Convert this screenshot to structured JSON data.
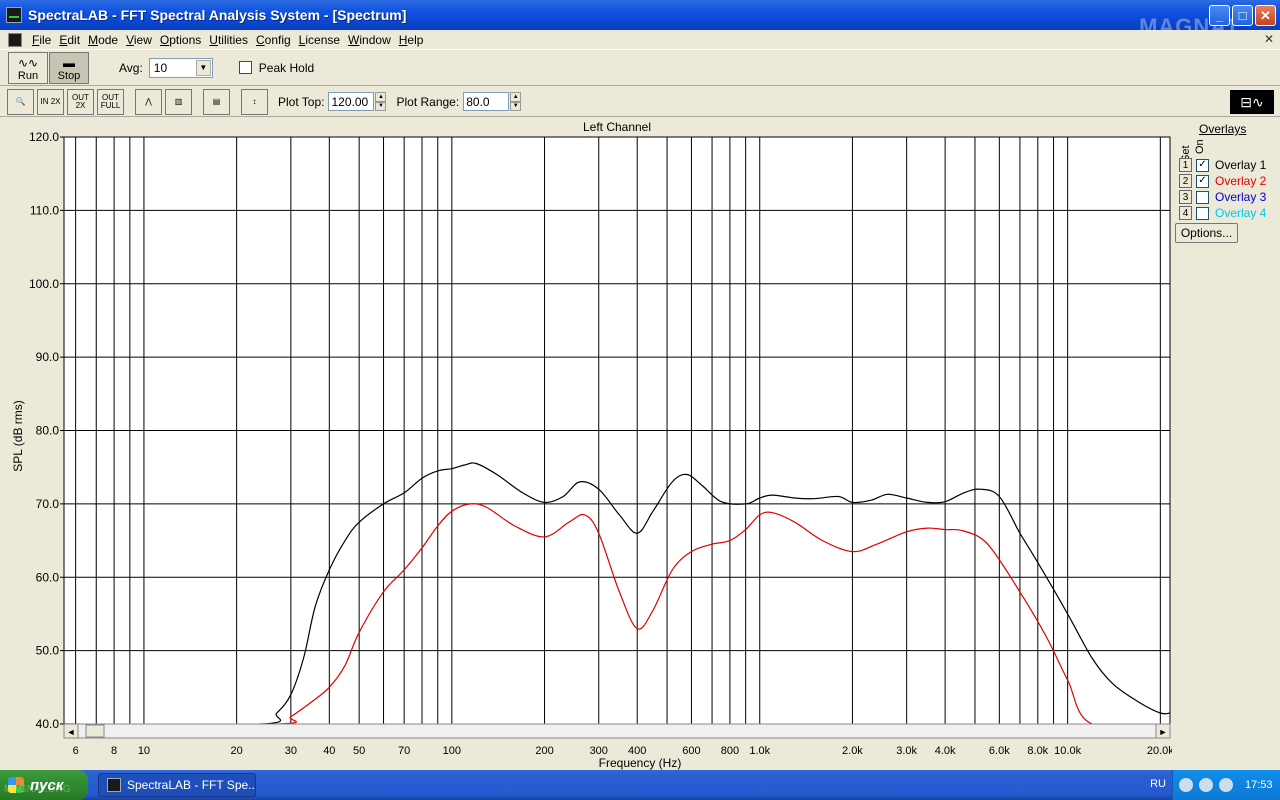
{
  "window": {
    "title": "SpectraLAB - FFT Spectral Analysis System - [Spectrum]",
    "watermark": "MAGNAT"
  },
  "menu": [
    "File",
    "Edit",
    "Mode",
    "View",
    "Options",
    "Utilities",
    "Config",
    "License",
    "Window",
    "Help"
  ],
  "toolbar": {
    "run_label": "Run",
    "stop_label": "Stop",
    "avg_label": "Avg:",
    "avg_value": "10",
    "peak_hold_label": "Peak Hold",
    "plot_top_label": "Plot Top:",
    "plot_top_value": "120.00",
    "plot_range_label": "Plot Range:",
    "plot_range_value": "80.0",
    "zoom_in_label": "IN 2X",
    "zoom_out_label": "OUT 2X",
    "zoom_full_label": "OUT FULL"
  },
  "overlays": {
    "title": "Overlays",
    "set_label": "Set",
    "on_label": "On",
    "options_label": "Options...",
    "items": [
      {
        "num": "1",
        "name": "Overlay 1",
        "checked": true,
        "color": "#000000"
      },
      {
        "num": "2",
        "name": "Overlay 2",
        "checked": true,
        "color": "#e00000"
      },
      {
        "num": "3",
        "name": "Overlay 3",
        "checked": false,
        "color": "#0000c0"
      },
      {
        "num": "4",
        "name": "Overlay 4",
        "checked": false,
        "color": "#00c8e8"
      }
    ]
  },
  "chart_data": {
    "type": "line",
    "title": "Left Channel",
    "xlabel": "Frequency (Hz)",
    "ylabel": "SPL (dB rms)",
    "xscale": "log",
    "xlim": [
      5.5,
      21500
    ],
    "ylim": [
      40,
      120
    ],
    "grid": true,
    "yticks": [
      "40.0",
      "50.0",
      "60.0",
      "70.0",
      "80.0",
      "90.0",
      "100.0",
      "110.0",
      "120.0"
    ],
    "xticks": [
      {
        "v": 6,
        "label": "6"
      },
      {
        "v": 8,
        "label": "8"
      },
      {
        "v": 10,
        "label": "10"
      },
      {
        "v": 20,
        "label": "20"
      },
      {
        "v": 30,
        "label": "30"
      },
      {
        "v": 40,
        "label": "40"
      },
      {
        "v": 50,
        "label": "50"
      },
      {
        "v": 70,
        "label": "70"
      },
      {
        "v": 100,
        "label": "100"
      },
      {
        "v": 200,
        "label": "200"
      },
      {
        "v": 300,
        "label": "300"
      },
      {
        "v": 400,
        "label": "400"
      },
      {
        "v": 600,
        "label": "600"
      },
      {
        "v": 800,
        "label": "800"
      },
      {
        "v": 1000,
        "label": "1.0k"
      },
      {
        "v": 2000,
        "label": "2.0k"
      },
      {
        "v": 3000,
        "label": "3.0k"
      },
      {
        "v": 4000,
        "label": "4.0k"
      },
      {
        "v": 6000,
        "label": "6.0k"
      },
      {
        "v": 8000,
        "label": "8.0k"
      },
      {
        "v": 10000,
        "label": "10.0k"
      },
      {
        "v": 20000,
        "label": "20.0k"
      }
    ],
    "series": [
      {
        "name": "Overlay 1",
        "color": "#000000",
        "points": [
          [
            5.5,
            40
          ],
          [
            24,
            40
          ],
          [
            27,
            41.5
          ],
          [
            30,
            44
          ],
          [
            33,
            49
          ],
          [
            36,
            56
          ],
          [
            40,
            61
          ],
          [
            45,
            65
          ],
          [
            50,
            67.5
          ],
          [
            60,
            70
          ],
          [
            70,
            71.5
          ],
          [
            80,
            73.5
          ],
          [
            90,
            74.5
          ],
          [
            100,
            74.8
          ],
          [
            110,
            75.3
          ],
          [
            120,
            75.5
          ],
          [
            140,
            74
          ],
          [
            170,
            71.5
          ],
          [
            200,
            70.2
          ],
          [
            230,
            71
          ],
          [
            260,
            73
          ],
          [
            300,
            72
          ],
          [
            350,
            68.5
          ],
          [
            400,
            66
          ],
          [
            450,
            69
          ],
          [
            520,
            73
          ],
          [
            580,
            74
          ],
          [
            650,
            72.5
          ],
          [
            750,
            70.3
          ],
          [
            900,
            70
          ],
          [
            1000,
            70.8
          ],
          [
            1100,
            71.2
          ],
          [
            1300,
            70.8
          ],
          [
            1500,
            70.7
          ],
          [
            1800,
            71
          ],
          [
            2000,
            70.2
          ],
          [
            2300,
            70.5
          ],
          [
            2600,
            71.3
          ],
          [
            3000,
            70.8
          ],
          [
            3500,
            70.2
          ],
          [
            4000,
            70.3
          ],
          [
            4600,
            71.5
          ],
          [
            5200,
            72
          ],
          [
            6000,
            71
          ],
          [
            7000,
            66
          ],
          [
            8000,
            62
          ],
          [
            10000,
            55
          ],
          [
            12000,
            49
          ],
          [
            14000,
            45.5
          ],
          [
            17000,
            43
          ],
          [
            20000,
            41.5
          ],
          [
            21500,
            41.5
          ]
        ]
      },
      {
        "name": "Overlay 2",
        "color": "#e00000",
        "points": [
          [
            5.5,
            40
          ],
          [
            27,
            40
          ],
          [
            30,
            41
          ],
          [
            35,
            43
          ],
          [
            40,
            45
          ],
          [
            45,
            48
          ],
          [
            50,
            52.5
          ],
          [
            60,
            58
          ],
          [
            70,
            61
          ],
          [
            80,
            64
          ],
          [
            90,
            67
          ],
          [
            100,
            69
          ],
          [
            115,
            70
          ],
          [
            130,
            69.5
          ],
          [
            160,
            67
          ],
          [
            200,
            65.5
          ],
          [
            240,
            67.5
          ],
          [
            270,
            68.5
          ],
          [
            300,
            66
          ],
          [
            350,
            58
          ],
          [
            400,
            53
          ],
          [
            450,
            55.5
          ],
          [
            520,
            61
          ],
          [
            600,
            63.5
          ],
          [
            700,
            64.5
          ],
          [
            800,
            65
          ],
          [
            900,
            66.5
          ],
          [
            1000,
            68.5
          ],
          [
            1100,
            68.8
          ],
          [
            1300,
            67.5
          ],
          [
            1600,
            65
          ],
          [
            2000,
            63.5
          ],
          [
            2400,
            64.5
          ],
          [
            3000,
            66.2
          ],
          [
            3500,
            66.7
          ],
          [
            4000,
            66.5
          ],
          [
            4600,
            66.3
          ],
          [
            5500,
            64.5
          ],
          [
            7000,
            58
          ],
          [
            8500,
            52
          ],
          [
            10000,
            46
          ],
          [
            12000,
            40
          ],
          [
            21500,
            40
          ]
        ]
      }
    ]
  },
  "taskbar": {
    "start_label": "пуск",
    "app_label": "SpectraLAB - FFT Spe...",
    "lang": "RU",
    "clock": "17:53",
    "watermark": "MAGNAT.ORG"
  }
}
